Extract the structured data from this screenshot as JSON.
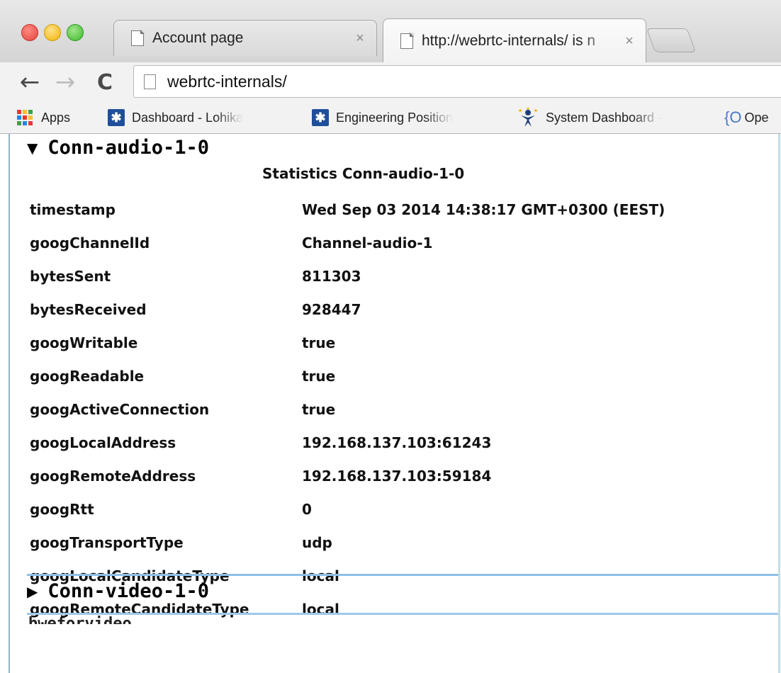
{
  "tabs": [
    {
      "title": "Account page",
      "close": "×",
      "active": false
    },
    {
      "title": "http://webrtc-internals/ is n",
      "close": "×",
      "active": true
    }
  ],
  "toolbar": {
    "back": "←",
    "forward": "→",
    "reload": "C",
    "url": "webrtc-internals/"
  },
  "bookmarks": [
    {
      "label": "Apps",
      "icon": "apps-grid-icon"
    },
    {
      "label": "Dashboard - Lohika",
      "icon": "jira-icon"
    },
    {
      "label": "Engineering Position",
      "icon": "jira-icon"
    },
    {
      "label": "System Dashboard -",
      "icon": "person-icon"
    },
    {
      "label": "Ope",
      "icon": "brace-icon"
    }
  ],
  "sections": {
    "audio": {
      "arrow": "▼",
      "title": "Conn-audio-1-0"
    },
    "video": {
      "arrow": "▶",
      "title": "Conn-video-1-0"
    }
  },
  "stats": {
    "caption": "Statistics Conn-audio-1-0",
    "rows": [
      {
        "key": "timestamp",
        "value": "Wed Sep 03 2014 14:38:17 GMT+0300 (EEST)"
      },
      {
        "key": "googChannelId",
        "value": "Channel-audio-1"
      },
      {
        "key": "bytesSent",
        "value": "811303"
      },
      {
        "key": "bytesReceived",
        "value": "928447"
      },
      {
        "key": "googWritable",
        "value": "true"
      },
      {
        "key": "googReadable",
        "value": "true"
      },
      {
        "key": "googActiveConnection",
        "value": "true"
      },
      {
        "key": "googLocalAddress",
        "value": "192.168.137.103:61243"
      },
      {
        "key": "googRemoteAddress",
        "value": "192.168.137.103:59184"
      },
      {
        "key": "googRtt",
        "value": "0"
      },
      {
        "key": "googTransportType",
        "value": "udp"
      },
      {
        "key": "googLocalCandidateType",
        "value": "local"
      },
      {
        "key": "googRemoteCandidateType",
        "value": "local"
      }
    ]
  },
  "cut_text": "bweforvideo",
  "colors": {
    "traffic_red": "#e0443e",
    "traffic_yellow": "#f0b400",
    "traffic_green": "#3fb82b",
    "jira_blue": "#1f4e9a",
    "section_rule": "#8ec0e8"
  }
}
